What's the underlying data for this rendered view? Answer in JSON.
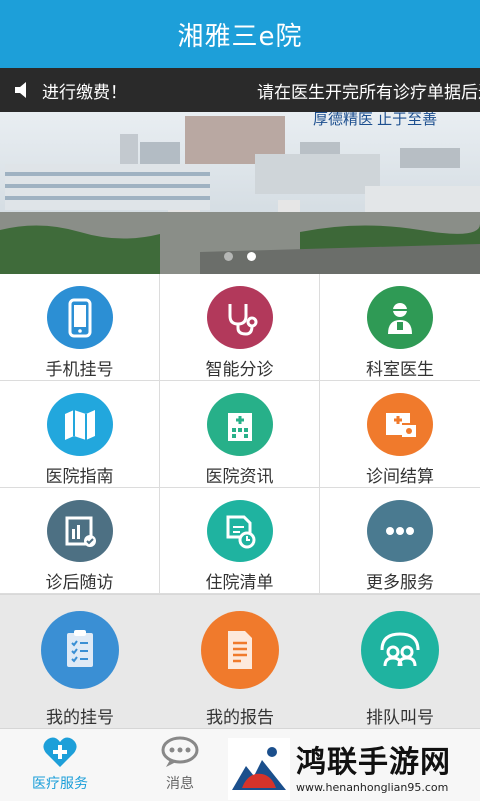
{
  "header": {
    "title": "湘雅三e院"
  },
  "notice": {
    "left_text": "进行缴费！",
    "right_text": "请在医生开完所有诊疗单据后进行缴费"
  },
  "banner": {
    "slogan": "厚德精医  止于至善"
  },
  "grid": {
    "items": [
      {
        "label": "手机挂号",
        "icon": "phone-icon",
        "color": "#2c8fd4"
      },
      {
        "label": "智能分诊",
        "icon": "stethoscope-icon",
        "color": "#b2395b"
      },
      {
        "label": "科室医生",
        "icon": "doctor-icon",
        "color": "#2f9a55"
      },
      {
        "label": "医院指南",
        "icon": "map-icon",
        "color": "#22a7dd"
      },
      {
        "label": "医院资讯",
        "icon": "hospital-icon",
        "color": "#27b089"
      },
      {
        "label": "诊间结算",
        "icon": "payment-icon",
        "color": "#f07a2c"
      },
      {
        "label": "诊后随访",
        "icon": "follow-up-icon",
        "color": "#4d7083"
      },
      {
        "label": "住院清单",
        "icon": "inpatient-list-icon",
        "color": "#1fb3a0"
      },
      {
        "label": "更多服务",
        "icon": "more-icon",
        "color": "#4a7a90"
      }
    ]
  },
  "quick": {
    "items": [
      {
        "label": "我的挂号",
        "icon": "clipboard-icon",
        "color": "#3a8fd4"
      },
      {
        "label": "我的报告",
        "icon": "report-icon",
        "color": "#f07a2c"
      },
      {
        "label": "排队叫号",
        "icon": "queue-icon",
        "color": "#1fb3a0"
      }
    ]
  },
  "tabbar": {
    "tabs": [
      {
        "label": "医疗服务",
        "active": true
      },
      {
        "label": "消息",
        "active": false
      }
    ]
  },
  "watermark": {
    "title": "鸿联手游网",
    "url": "www.henanhonglian95.com"
  },
  "colors": {
    "primary": "#1d9fd9",
    "notice_bg": "#2a2a2a"
  }
}
